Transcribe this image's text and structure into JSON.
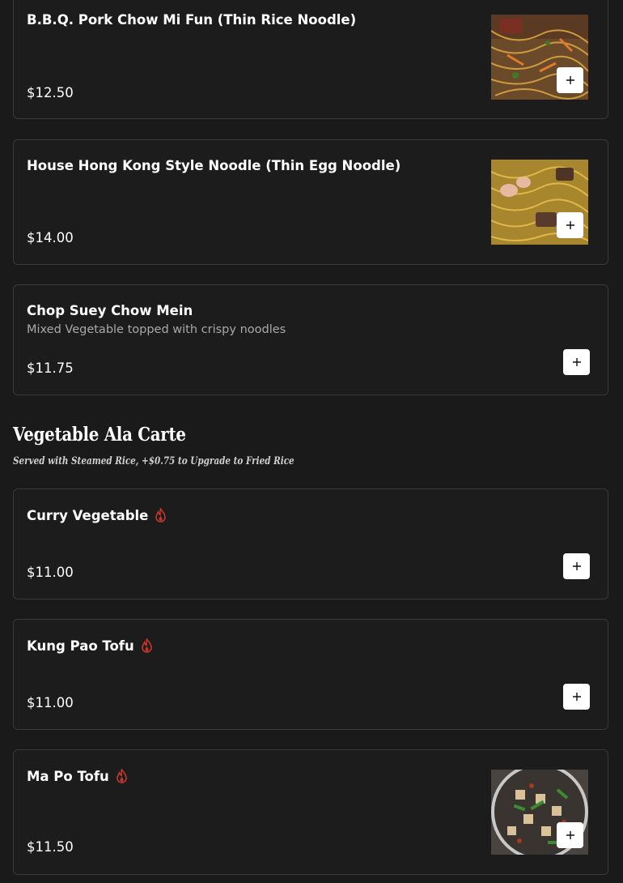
{
  "colors": {
    "background": "#1a1a1a",
    "card_border": "#3a3a3a",
    "spicy_icon": "#c9352b",
    "add_button": "#ffffff"
  },
  "items_top": [
    {
      "name": "B.B.Q. Pork Chow Mi Fun (Thin Rice Noodle)",
      "price": "$12.50",
      "has_image": true,
      "image_icon": "noodle-dish-photo"
    },
    {
      "name": "House Hong Kong Style Noodle (Thin Egg Noodle)",
      "price": "$14.00",
      "has_image": true,
      "image_icon": "noodle-dish-photo"
    },
    {
      "name": "Chop Suey Chow Mein",
      "description": "Mixed Vegetable topped with crispy noodles",
      "price": "$11.75",
      "has_image": false
    }
  ],
  "section": {
    "title": "Vegetable Ala Carte",
    "subtitle": "Served with Steamed Rice, +$0.75 to Upgrade to Fried Rice"
  },
  "items_section": [
    {
      "name": "Curry Vegetable",
      "spicy": true,
      "price": "$11.00",
      "has_image": false
    },
    {
      "name": "Kung Pao Tofu",
      "spicy": true,
      "price": "$11.00",
      "has_image": false
    },
    {
      "name": "Ma Po Tofu",
      "spicy": true,
      "price": "$11.50",
      "has_image": true,
      "image_icon": "tofu-dish-photo"
    }
  ],
  "add_button_icon": "plus-icon",
  "spicy_icon": "fire-icon"
}
